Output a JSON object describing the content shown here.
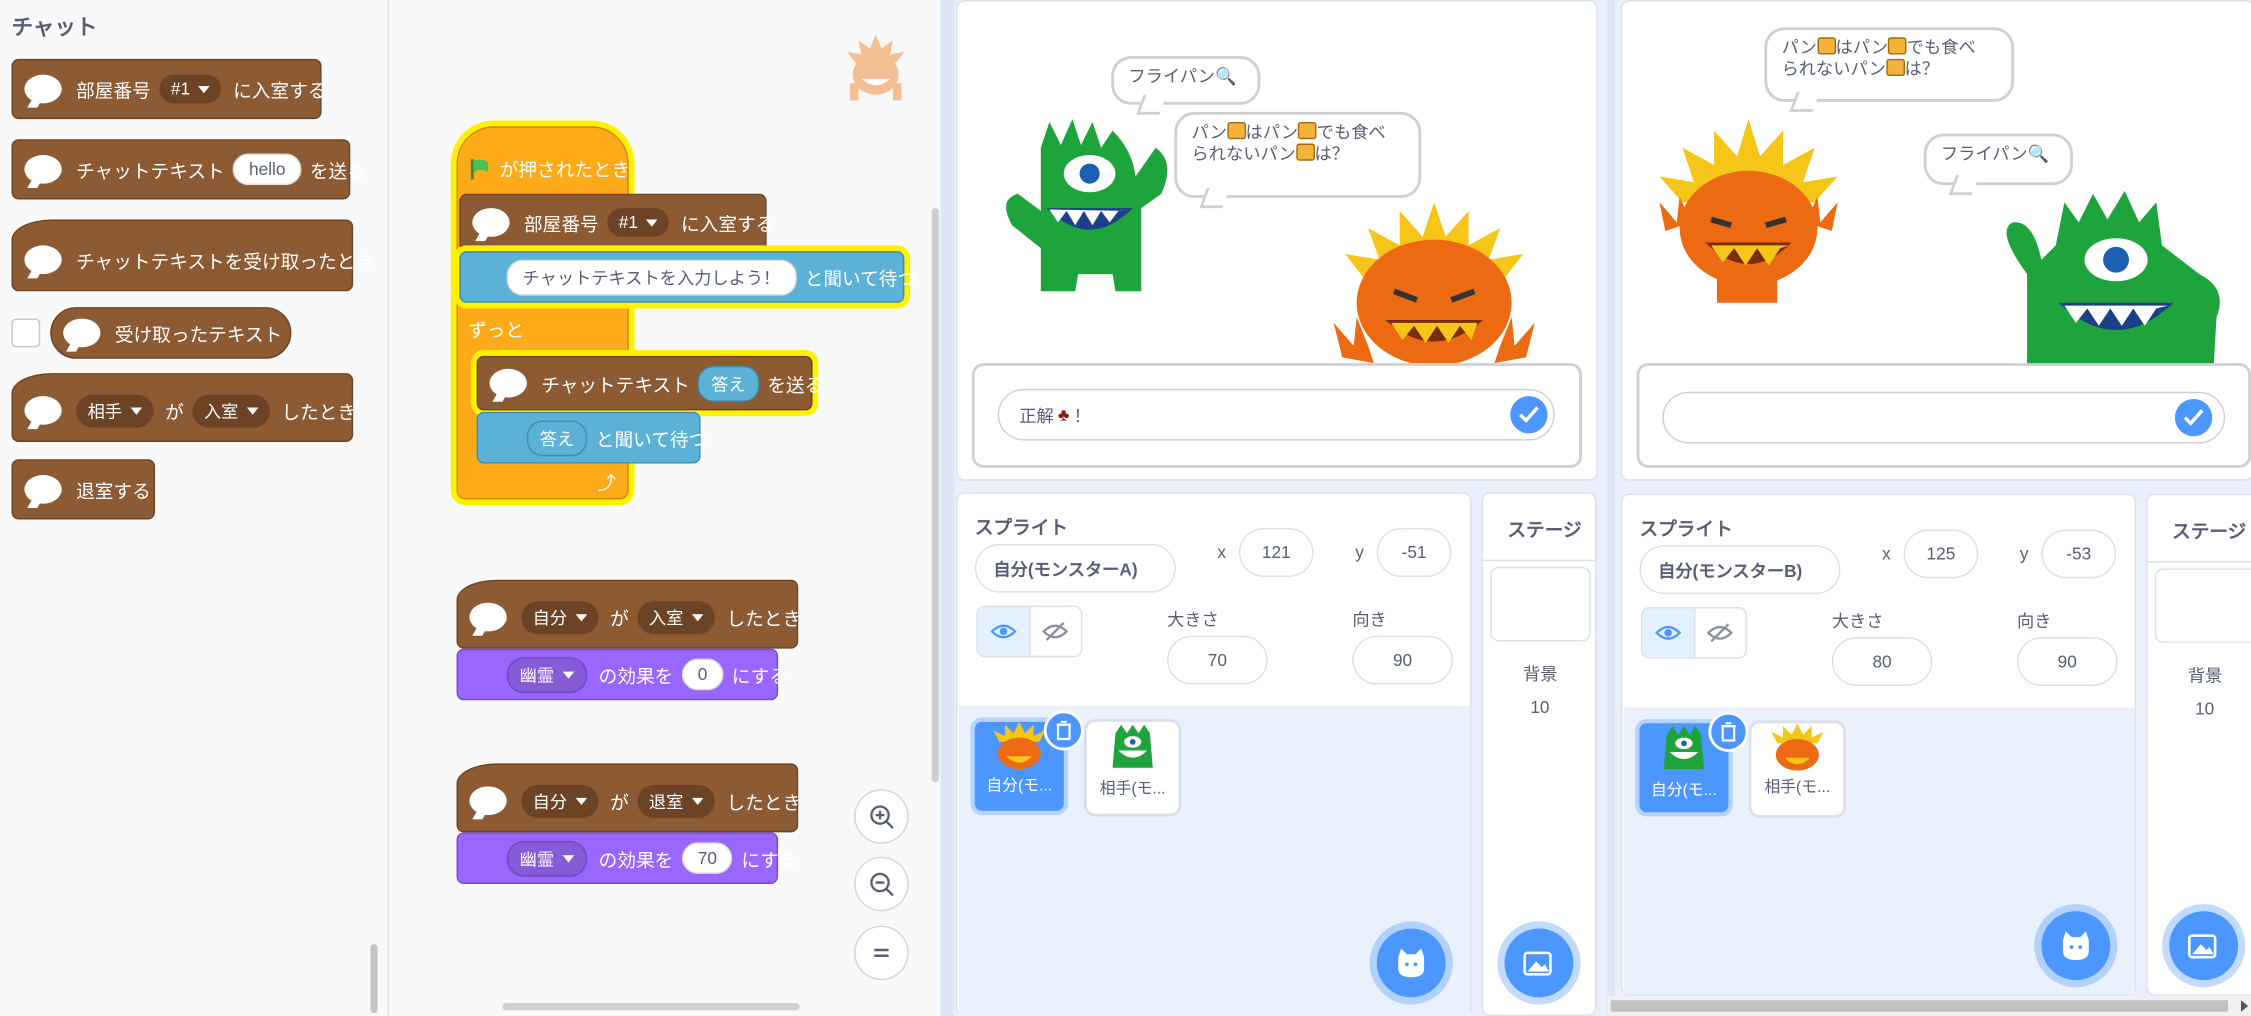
{
  "palette": {
    "title": "チャット",
    "blocks": [
      {
        "parts": [
          "部屋番号",
          "#1",
          "に入室する"
        ]
      },
      {
        "parts": [
          "チャットテキスト",
          "hello",
          "を送る"
        ]
      },
      {
        "parts": [
          "チャットテキストを受け取ったとき"
        ]
      },
      {
        "parts": [
          "受け取ったテキスト"
        ]
      },
      {
        "parts": [
          "相手",
          "が",
          "入室",
          "したとき"
        ]
      },
      {
        "parts": [
          "退室する"
        ]
      }
    ]
  },
  "script1": {
    "hat": "が押されたとき",
    "join": [
      "部屋番号",
      "#1",
      "に入室する"
    ],
    "ask": [
      "チャットテキストを入力しよう！",
      "と聞いて待つ"
    ],
    "forever": "ずっと",
    "send": [
      "チャットテキスト",
      "答え",
      "を送る"
    ],
    "ask2": [
      "答え",
      "と聞いて待つ"
    ]
  },
  "script2": {
    "hat": [
      "自分",
      "が",
      "入室",
      "したとき"
    ],
    "effect": [
      "幽霊",
      "の効果を",
      "0",
      "にする"
    ]
  },
  "script3": {
    "hat": [
      "自分",
      "が",
      "退室",
      "したとき"
    ],
    "effect": [
      "幽霊",
      "の効果を",
      "70",
      "にする"
    ]
  },
  "stageA": {
    "bubble_small": "フライパン",
    "bubble_large_1": "パン",
    "bubble_large_2": "はパン",
    "bubble_large_3": "でも食べ",
    "bubble_large_4": "られないパン",
    "bubble_large_5": "は？",
    "answer": "正解",
    "answer_suffix": "！"
  },
  "stageB": {
    "bubble_small": "フライパン",
    "bubble_large_1": "パン",
    "bubble_large_2": "はパン",
    "bubble_large_3": "でも食べ",
    "bubble_large_4": "られないパン",
    "bubble_large_5": "は？",
    "answer": ""
  },
  "spriteA": {
    "label": "スプライト",
    "name": "自分(モンスターA)",
    "x_label": "x",
    "x": "121",
    "y_label": "y",
    "y": "-51",
    "size_label": "大きさ",
    "size": "70",
    "dir_label": "向き",
    "dir": "90",
    "thumb1": "自分(モ...",
    "thumb2": "相手(モ...",
    "stage_label": "ステージ",
    "bg_label": "背景",
    "bg_count": "10"
  },
  "spriteB": {
    "label": "スプライト",
    "name": "自分(モンスターB)",
    "x_label": "x",
    "x": "125",
    "y_label": "y",
    "y": "-53",
    "size_label": "大きさ",
    "size": "80",
    "dir_label": "向き",
    "dir": "90",
    "thumb1": "自分(モ...",
    "thumb2": "相手(モ...",
    "stage_label": "ステージ",
    "bg_label": "背景",
    "bg_count": "10"
  },
  "colors": {
    "chat": "#8c5a33",
    "events": "#ffab19",
    "sensing": "#5cb1d6",
    "looks": "#9966ff",
    "accent": "#4c97ff"
  }
}
